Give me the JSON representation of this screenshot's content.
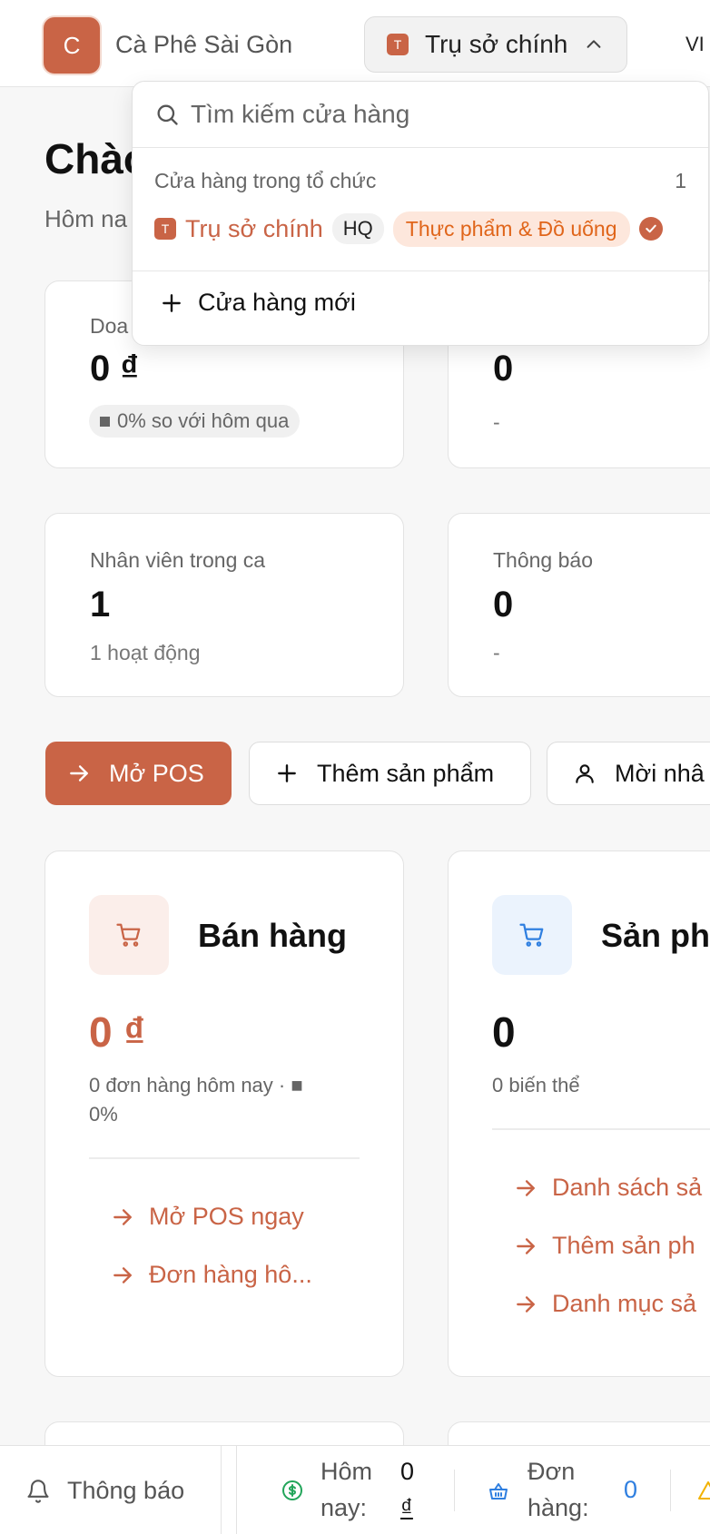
{
  "header": {
    "logo_letter": "C",
    "brand_name": "Cà Phê Sài Gòn",
    "store_selector": {
      "icon_letter": "T",
      "label": "Trụ sở chính"
    },
    "language": "VI"
  },
  "greeting": {
    "title": "Chào",
    "subtitle": "Hôm na"
  },
  "stats": [
    {
      "label": "Doa",
      "value": "0 ₫",
      "change": "0% so với hôm qua"
    },
    {
      "label": "",
      "value": "0",
      "sub": "-"
    },
    {
      "label": "Nhân viên trong ca",
      "value": "1",
      "sub": "1 hoạt động"
    },
    {
      "label": "Thông báo",
      "value": "0",
      "sub": "-"
    }
  ],
  "actions": {
    "open_pos": "Mở POS",
    "add_product": "Thêm sản phẩm",
    "invite_staff": "Mời nhâ"
  },
  "modules": [
    {
      "title": "Bán hàng",
      "value": "0 ₫",
      "sub_line1": "0 đơn hàng hôm nay · ■",
      "sub_line2": "0%",
      "links": [
        "Mở POS ngay",
        "Đơn hàng hô..."
      ],
      "icon": "cart-icon",
      "icon_color": "#c96446",
      "icon_bg": "#fbeeea"
    },
    {
      "title": "Sản ph",
      "value": "0",
      "sub_line1": "0 biến thể",
      "links": [
        "Danh sách sả",
        "Thêm sản ph",
        "Danh mục sả"
      ],
      "icon": "cart-icon",
      "icon_color": "#2f7fe0",
      "icon_bg": "#ebf3fd"
    }
  ],
  "bottom_bar": {
    "notifications": "Thông báo",
    "today_label_1": "Hôm",
    "today_label_2": "nay:",
    "today_value_1": "0",
    "today_value_2": "₫",
    "orders_label_1": "Đơn",
    "orders_label_2": "hàng:",
    "orders_value": "0"
  },
  "dropdown": {
    "search_placeholder": "Tìm kiếm cửa hàng",
    "group_label": "Cửa hàng trong tổ chức",
    "group_count": "1",
    "store": {
      "icon_letter": "T",
      "name": "Trụ sở chính",
      "badge": "HQ",
      "category": "Thực phẩm & Đồ uống"
    },
    "new_store": "Cửa hàng mới"
  },
  "colors": {
    "accent": "#c96446",
    "money_green": "#22a55a",
    "orders_blue": "#2f7fe0",
    "warning": "#f2b200"
  }
}
